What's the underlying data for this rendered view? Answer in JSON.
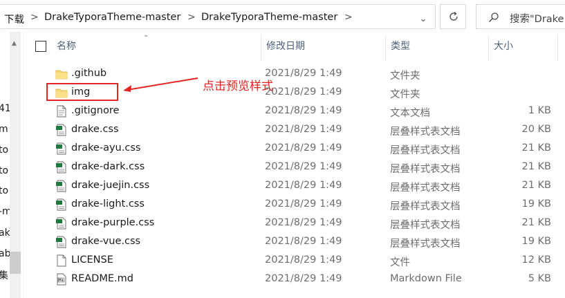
{
  "address_bar": {
    "crumbs": [
      "下载",
      "DrakeTyporaTheme-master",
      "DrakeTyporaTheme-master"
    ],
    "separator": ">"
  },
  "search": {
    "placeholder": "搜索\"Drake"
  },
  "nav_fragments": [
    "41",
    "m",
    "to",
    "to",
    "to",
    "-m",
    "ak",
    "ab",
    "集"
  ],
  "columns": {
    "name": "名称",
    "date": "修改日期",
    "type": "类型",
    "size": "大小"
  },
  "files": [
    {
      "name": ".github",
      "date": "2021/8/29 1:49",
      "type": "文件夹",
      "size": "",
      "icon": "folder-icon"
    },
    {
      "name": "img",
      "date": "2021/8/29 1:49",
      "type": "文件夹",
      "size": "",
      "icon": "folder-icon"
    },
    {
      "name": ".gitignore",
      "date": "2021/8/29 1:49",
      "type": "文本文档",
      "size": "1 KB",
      "icon": "text-file-icon"
    },
    {
      "name": "drake.css",
      "date": "2021/8/29 1:49",
      "type": "层叠样式表文档",
      "size": "20 KB",
      "icon": "css-file-icon"
    },
    {
      "name": "drake-ayu.css",
      "date": "2021/8/29 1:49",
      "type": "层叠样式表文档",
      "size": "21 KB",
      "icon": "css-file-icon"
    },
    {
      "name": "drake-dark.css",
      "date": "2021/8/29 1:49",
      "type": "层叠样式表文档",
      "size": "21 KB",
      "icon": "css-file-icon"
    },
    {
      "name": "drake-juejin.css",
      "date": "2021/8/29 1:49",
      "type": "层叠样式表文档",
      "size": "21 KB",
      "icon": "css-file-icon"
    },
    {
      "name": "drake-light.css",
      "date": "2021/8/29 1:49",
      "type": "层叠样式表文档",
      "size": "19 KB",
      "icon": "css-file-icon"
    },
    {
      "name": "drake-purple.css",
      "date": "2021/8/29 1:49",
      "type": "层叠样式表文档",
      "size": "21 KB",
      "icon": "css-file-icon"
    },
    {
      "name": "drake-vue.css",
      "date": "2021/8/29 1:49",
      "type": "层叠样式表文档",
      "size": "19 KB",
      "icon": "css-file-icon"
    },
    {
      "name": "LICENSE",
      "date": "2021/8/29 1:49",
      "type": "文件",
      "size": "12 KB",
      "icon": "blank-file-icon"
    },
    {
      "name": "README.md",
      "date": "2021/8/29 1:49",
      "type": "Markdown File",
      "size": "5 KB",
      "icon": "markdown-file-icon"
    }
  ],
  "annotation": {
    "text": "点击预览样式",
    "color": "#e52421"
  },
  "colors": {
    "folder": "#f8d775",
    "folder_dark": "#e0a82e",
    "css_green": "#1e7a3c",
    "header_text": "#4c607a"
  }
}
